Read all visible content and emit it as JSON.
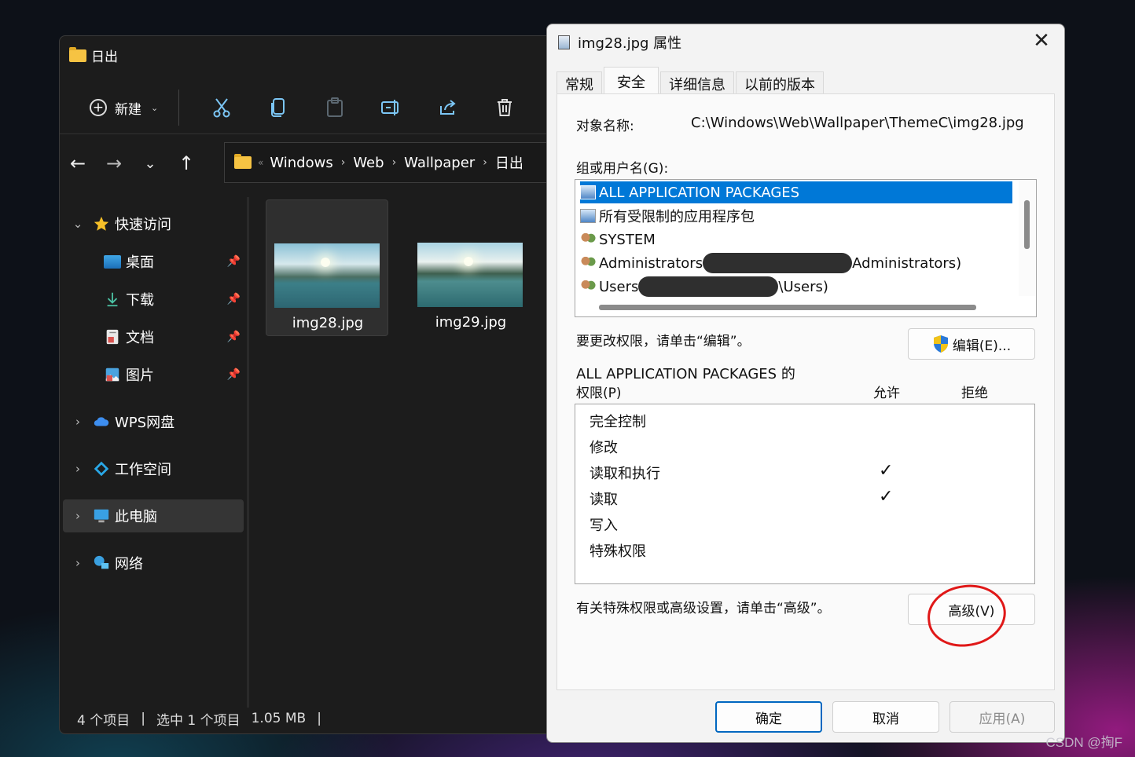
{
  "explorer": {
    "title": "日出",
    "toolbar": {
      "new_label": "新建"
    },
    "breadcrumb": [
      "Windows",
      "Web",
      "Wallpaper",
      "日出"
    ],
    "sidebar": [
      {
        "label": "快速访问",
        "icon": "star-icon"
      },
      {
        "label": "桌面",
        "icon": "desktop-icon",
        "pinned": true
      },
      {
        "label": "下载",
        "icon": "download-icon",
        "pinned": true
      },
      {
        "label": "文档",
        "icon": "document-icon",
        "pinned": true
      },
      {
        "label": "图片",
        "icon": "picture-icon",
        "pinned": true
      },
      {
        "label": "WPS网盘",
        "icon": "cloud-icon"
      },
      {
        "label": "工作空间",
        "icon": "workspace-icon"
      },
      {
        "label": "此电脑",
        "icon": "computer-icon",
        "selected": true
      },
      {
        "label": "网络",
        "icon": "network-icon"
      }
    ],
    "files": [
      {
        "name": "img28.jpg",
        "selected": true
      },
      {
        "name": "img29.jpg",
        "selected": false
      }
    ],
    "status": {
      "count": "4 个项目",
      "selection": "选中 1 个项目",
      "size": "1.05 MB"
    }
  },
  "dialog": {
    "title": "img28.jpg 属性",
    "tabs": [
      "常规",
      "安全",
      "详细信息",
      "以前的版本"
    ],
    "object_label": "对象名称:",
    "object_path": "C:\\Windows\\Web\\Wallpaper\\ThemeC\\img28.jpg",
    "group_label": "组或用户名(G):",
    "users": [
      {
        "name": "ALL APPLICATION PACKAGES",
        "suffix": "",
        "selected": true
      },
      {
        "name": "所有受限制的应用程序包",
        "suffix": ""
      },
      {
        "name": "SYSTEM",
        "suffix": ""
      },
      {
        "name": "Administrators",
        "suffix": "Administrators)"
      },
      {
        "name": "Users",
        "suffix": "\\Users)"
      }
    ],
    "edit_hint": "要更改权限，请单击“编辑”。",
    "edit_button": "编辑(E)...",
    "perm_for_line1": "ALL APPLICATION PACKAGES 的",
    "perm_for_line2": "权限(P)",
    "allow_header": "允许",
    "deny_header": "拒绝",
    "permissions": [
      {
        "name": "完全控制",
        "allow": false
      },
      {
        "name": "修改",
        "allow": false
      },
      {
        "name": "读取和执行",
        "allow": true
      },
      {
        "name": "读取",
        "allow": true
      },
      {
        "name": "写入",
        "allow": false
      },
      {
        "name": "特殊权限",
        "allow": false
      }
    ],
    "advanced_hint": "有关特殊权限或高级设置，请单击“高级”。",
    "advanced_button": "高级(V)",
    "ok_button": "确定",
    "cancel_button": "取消",
    "apply_button": "应用(A)"
  },
  "watermark": "CSDN @掏F",
  "colors": {
    "selection": "#0078d7",
    "annotation": "#e01818",
    "explorer_bg": "#1c1c1c"
  }
}
